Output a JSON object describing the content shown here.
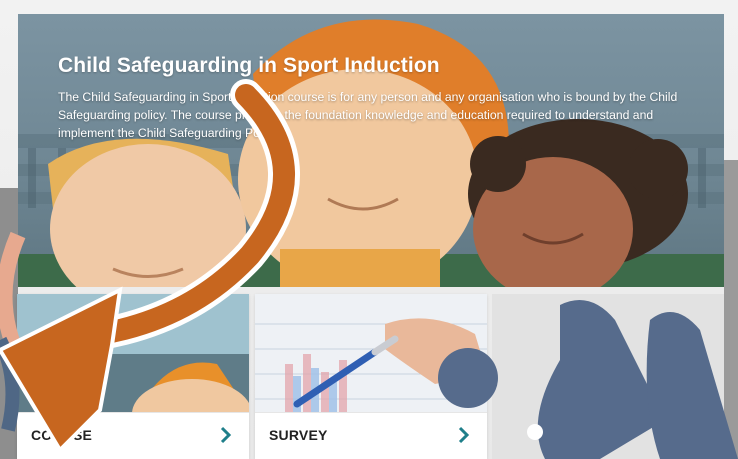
{
  "hero": {
    "title": "Child Safeguarding in Sport Induction",
    "description": "The Child Safeguarding in Sport Induction course is for any person and any organisation who is bound by the Child Safeguarding policy. The course provides the foundation knowledge and education required to understand and implement the Child Safeguarding Policy."
  },
  "tiles": [
    {
      "label": "COURSE",
      "icon": "chevron-right-icon"
    },
    {
      "label": "SURVEY",
      "icon": "chevron-right-icon"
    }
  ],
  "colors": {
    "accent_orange": "#c7661f",
    "accent_teal": "#2a8f98",
    "splash_blue": "#566b8c",
    "hero_sky": "#7c94a2"
  }
}
